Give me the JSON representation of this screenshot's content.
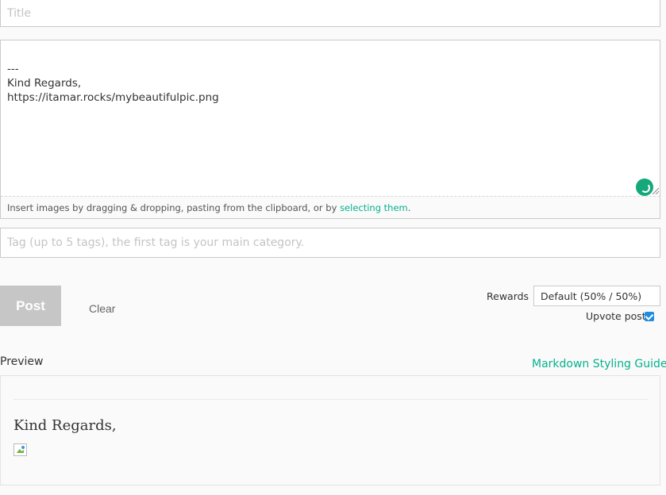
{
  "editor": {
    "title_placeholder": "Title",
    "body": "---\nKind Regards,\nhttps://itamar.rocks/mybeautifulpic.png",
    "dropzone_text": "Insert images by dragging & dropping, pasting from the clipboard, or by ",
    "dropzone_link": "selecting them",
    "dropzone_suffix": ".",
    "tags_placeholder": "Tag (up to 5 tags), the first tag is your main category."
  },
  "actions": {
    "post_label": "Post",
    "clear_label": "Clear"
  },
  "options": {
    "rewards_label": "Rewards",
    "rewards_value": "Default (50% / 50%)",
    "upvote_label": "Upvote post",
    "upvote_checked": true
  },
  "preview": {
    "label": "Preview",
    "guide_link": "Markdown Styling Guide",
    "rendered_text": "Kind Regards,"
  },
  "colors": {
    "accent": "#07b18e",
    "checkbox": "#1e8de0",
    "post_disabled": "#c6c6c6"
  },
  "icons": {
    "grammar_checker": "circle-check-icon",
    "broken_image": "broken-image-icon"
  }
}
